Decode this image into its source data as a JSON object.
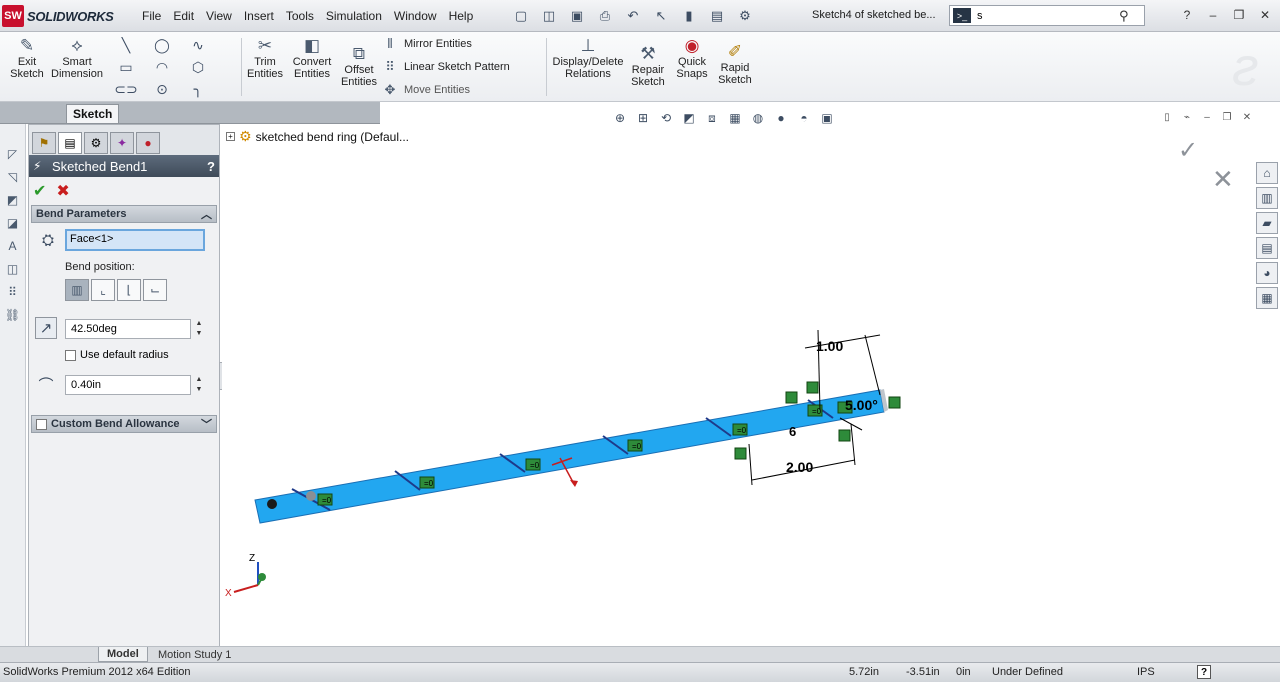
{
  "app": {
    "logo_badge": "SW",
    "logo_text": "SOLIDWORKS",
    "status_edition": "SolidWorks Premium 2012 x64 Edition"
  },
  "menu": [
    "File",
    "Edit",
    "View",
    "Insert",
    "Tools",
    "Simulation",
    "Window",
    "Help"
  ],
  "document_title": "Sketch4 of sketched be...",
  "search": {
    "value": "s"
  },
  "ribbon": {
    "exit_sketch": "Exit Sketch",
    "smart_dimension": "Smart Dimension",
    "trim_entities": "Trim Entities",
    "convert_entities": "Convert Entities",
    "offset_entities": "Offset Entities",
    "mirror_entities": "Mirror Entities",
    "linear_sketch_pattern": "Linear Sketch Pattern",
    "move_entities": "Move Entities",
    "display_delete_relations": "Display/Delete Relations",
    "repair_sketch": "Repair Sketch",
    "quick_snaps": "Quick Snaps",
    "rapid_sketch": "Rapid Sketch"
  },
  "tabs": {
    "sketch": "Sketch"
  },
  "property_manager": {
    "title": "Sketched Bend1",
    "help": "?",
    "bend_parameters": "Bend Parameters",
    "face_value": "Face<1>",
    "bend_position_label": "Bend position:",
    "angle_value": "42.50deg",
    "use_default_radius": "Use default radius",
    "radius_value": "0.40in",
    "custom_bend_allowance": "Custom Bend Allowance"
  },
  "feature_tree": {
    "part_name": "sketched bend ring  (Defaul..."
  },
  "bottom_tabs": {
    "model": "Model",
    "motion_study": "Motion Study 1"
  },
  "status": {
    "x": "5.72in",
    "y": "-3.51in",
    "z": "0in",
    "state": "Under Defined",
    "units": "IPS"
  },
  "sketch_dims": {
    "d1": "1.00",
    "d2": "5.00°",
    "d3": "2.00",
    "d4": "6",
    "relation": "=0"
  },
  "triad": {
    "z": "Z",
    "x": "X"
  },
  "colors": {
    "part_face": "#22a7f0",
    "part_edge": "#1e5aa8",
    "relation_green": "#2e8b3a",
    "pm_header": "#4a5766"
  }
}
